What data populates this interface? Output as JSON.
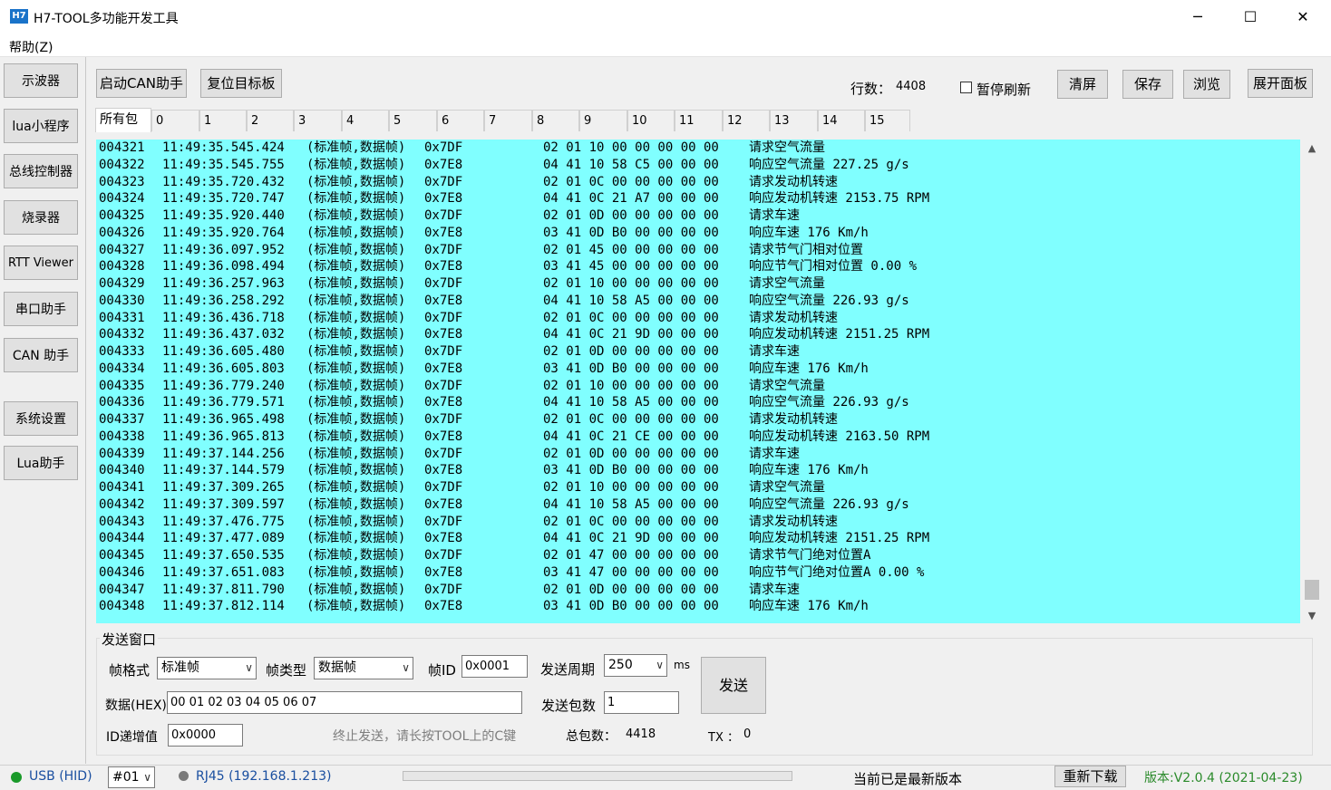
{
  "window": {
    "icon_text": "H7",
    "title": "H7-TOOL多功能开发工具",
    "minimize": "─",
    "maximize": "☐",
    "close": "✕"
  },
  "menu": {
    "help": "帮助(Z)"
  },
  "sidebar": {
    "items": [
      "示波器",
      "lua小程序",
      "总线控制器",
      "烧录器",
      "RTT Viewer",
      "串口助手",
      "CAN 助手",
      "系统设置",
      "Lua助手"
    ]
  },
  "toolbar": {
    "start_can": "启动CAN助手",
    "reset_target": "复位目标板",
    "rows_label": "行数：",
    "rows_value": "4408",
    "pause_refresh": "暂停刷新",
    "pause_checked": false,
    "clear": "清屏",
    "save": "保存",
    "browse": "浏览",
    "expand_panel": "展开面板"
  },
  "tabs": [
    "所有包",
    "0",
    "1",
    "2",
    "3",
    "4",
    "5",
    "6",
    "7",
    "8",
    "9",
    "10",
    "11",
    "12",
    "13",
    "14",
    "15"
  ],
  "log": {
    "background": "#80ffff",
    "columns": [
      "seq",
      "time",
      "type",
      "id",
      "data",
      "desc"
    ],
    "rows": [
      [
        "004321",
        "11:49:35.545.424",
        "(标准帧,数据帧)",
        "0x7DF",
        "02 01 10 00 00 00 00 00",
        "请求空气流量"
      ],
      [
        "004322",
        "11:49:35.545.755",
        "(标准帧,数据帧)",
        "0x7E8",
        "04 41 10 58 C5 00 00 00",
        "响应空气流量 227.25 g/s"
      ],
      [
        "004323",
        "11:49:35.720.432",
        "(标准帧,数据帧)",
        "0x7DF",
        "02 01 0C 00 00 00 00 00",
        "请求发动机转速"
      ],
      [
        "004324",
        "11:49:35.720.747",
        "(标准帧,数据帧)",
        "0x7E8",
        "04 41 0C 21 A7 00 00 00",
        "响应发动机转速 2153.75 RPM"
      ],
      [
        "004325",
        "11:49:35.920.440",
        "(标准帧,数据帧)",
        "0x7DF",
        "02 01 0D 00 00 00 00 00",
        "请求车速"
      ],
      [
        "004326",
        "11:49:35.920.764",
        "(标准帧,数据帧)",
        "0x7E8",
        "03 41 0D B0 00 00 00 00",
        "响应车速 176 Km/h"
      ],
      [
        "004327",
        "11:49:36.097.952",
        "(标准帧,数据帧)",
        "0x7DF",
        "02 01 45 00 00 00 00 00",
        "请求节气门相对位置"
      ],
      [
        "004328",
        "11:49:36.098.494",
        "(标准帧,数据帧)",
        "0x7E8",
        "03 41 45 00 00 00 00 00",
        "响应节气门相对位置 0.00 %"
      ],
      [
        "004329",
        "11:49:36.257.963",
        "(标准帧,数据帧)",
        "0x7DF",
        "02 01 10 00 00 00 00 00",
        "请求空气流量"
      ],
      [
        "004330",
        "11:49:36.258.292",
        "(标准帧,数据帧)",
        "0x7E8",
        "04 41 10 58 A5 00 00 00",
        "响应空气流量 226.93 g/s"
      ],
      [
        "004331",
        "11:49:36.436.718",
        "(标准帧,数据帧)",
        "0x7DF",
        "02 01 0C 00 00 00 00 00",
        "请求发动机转速"
      ],
      [
        "004332",
        "11:49:36.437.032",
        "(标准帧,数据帧)",
        "0x7E8",
        "04 41 0C 21 9D 00 00 00",
        "响应发动机转速 2151.25 RPM"
      ],
      [
        "004333",
        "11:49:36.605.480",
        "(标准帧,数据帧)",
        "0x7DF",
        "02 01 0D 00 00 00 00 00",
        "请求车速"
      ],
      [
        "004334",
        "11:49:36.605.803",
        "(标准帧,数据帧)",
        "0x7E8",
        "03 41 0D B0 00 00 00 00",
        "响应车速 176 Km/h"
      ],
      [
        "004335",
        "11:49:36.779.240",
        "(标准帧,数据帧)",
        "0x7DF",
        "02 01 10 00 00 00 00 00",
        "请求空气流量"
      ],
      [
        "004336",
        "11:49:36.779.571",
        "(标准帧,数据帧)",
        "0x7E8",
        "04 41 10 58 A5 00 00 00",
        "响应空气流量 226.93 g/s"
      ],
      [
        "004337",
        "11:49:36.965.498",
        "(标准帧,数据帧)",
        "0x7DF",
        "02 01 0C 00 00 00 00 00",
        "请求发动机转速"
      ],
      [
        "004338",
        "11:49:36.965.813",
        "(标准帧,数据帧)",
        "0x7E8",
        "04 41 0C 21 CE 00 00 00",
        "响应发动机转速 2163.50 RPM"
      ],
      [
        "004339",
        "11:49:37.144.256",
        "(标准帧,数据帧)",
        "0x7DF",
        "02 01 0D 00 00 00 00 00",
        "请求车速"
      ],
      [
        "004340",
        "11:49:37.144.579",
        "(标准帧,数据帧)",
        "0x7E8",
        "03 41 0D B0 00 00 00 00",
        "响应车速 176 Km/h"
      ],
      [
        "004341",
        "11:49:37.309.265",
        "(标准帧,数据帧)",
        "0x7DF",
        "02 01 10 00 00 00 00 00",
        "请求空气流量"
      ],
      [
        "004342",
        "11:49:37.309.597",
        "(标准帧,数据帧)",
        "0x7E8",
        "04 41 10 58 A5 00 00 00",
        "响应空气流量 226.93 g/s"
      ],
      [
        "004343",
        "11:49:37.476.775",
        "(标准帧,数据帧)",
        "0x7DF",
        "02 01 0C 00 00 00 00 00",
        "请求发动机转速"
      ],
      [
        "004344",
        "11:49:37.477.089",
        "(标准帧,数据帧)",
        "0x7E8",
        "04 41 0C 21 9D 00 00 00",
        "响应发动机转速 2151.25 RPM"
      ],
      [
        "004345",
        "11:49:37.650.535",
        "(标准帧,数据帧)",
        "0x7DF",
        "02 01 47 00 00 00 00 00",
        "请求节气门绝对位置A"
      ],
      [
        "004346",
        "11:49:37.651.083",
        "(标准帧,数据帧)",
        "0x7E8",
        "03 41 47 00 00 00 00 00",
        "响应节气门绝对位置A 0.00 %"
      ],
      [
        "004347",
        "11:49:37.811.790",
        "(标准帧,数据帧)",
        "0x7DF",
        "02 01 0D 00 00 00 00 00",
        "请求车速"
      ],
      [
        "004348",
        "11:49:37.812.114",
        "(标准帧,数据帧)",
        "0x7E8",
        "03 41 0D B0 00 00 00 00",
        "响应车速 176 Km/h"
      ]
    ]
  },
  "send": {
    "group_title": "发送窗口",
    "frame_format_label": "帧格式",
    "frame_format_value": "标准帧",
    "frame_type_label": "帧类型",
    "frame_type_value": "数据帧",
    "frame_id_label": "帧ID",
    "frame_id_value": "0x0001",
    "period_label": "发送周期",
    "period_value": "250",
    "period_unit": "ms",
    "send_button": "发送",
    "data_label": "数据(HEX)",
    "data_value": "00 01 02 03 04 05 06 07",
    "count_label": "发送包数",
    "count_value": "1",
    "id_inc_label": "ID递增值",
    "id_inc_value": "0x0000",
    "hint": "终止发送，请长按TOOL上的C键",
    "total_label": "总包数：",
    "total_value": "4418",
    "tx_label": "TX ：",
    "tx_value": "0"
  },
  "status": {
    "usb_text": "USB (HID)",
    "usb_color": "#1a9a2a",
    "device_value": "#01",
    "rj45_text": "RJ45 (192.168.1.213)",
    "rj45_color": "#7a7a7a",
    "link_color": "#1a4fa0",
    "progress": 0,
    "update_text": "当前已是最新版本",
    "redownload": "重新下载",
    "version": "版本:V2.0.4 (2021-04-23)",
    "version_color": "#2a8a2a"
  }
}
